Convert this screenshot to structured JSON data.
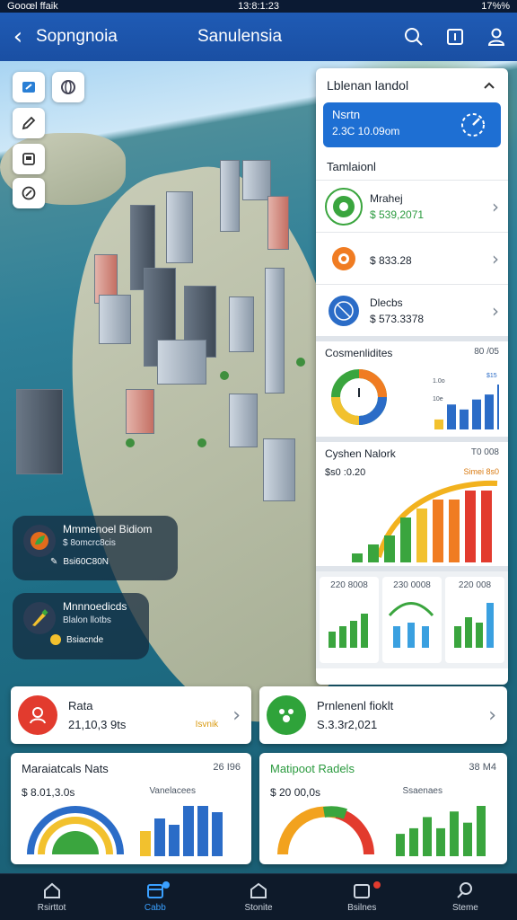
{
  "status": {
    "carrier": "Gooœl ffaik",
    "time": "13:8:1:23",
    "battery": "17%%"
  },
  "header": {
    "left_title": "Sopngnoia",
    "center_title": "Sanulensia"
  },
  "map_pois": [
    {
      "title": "Mmmenoel Bidiom",
      "subtitle": "$ 8omcrc8cis",
      "detail": "Bsi60C80N"
    },
    {
      "title": "Mnnnoedicds",
      "subtitle": "Blalon llotbs",
      "detail": "Bsiacnde"
    }
  ],
  "panel": {
    "title": "Lblenan landol",
    "featured": {
      "name": "Nsrtn",
      "value": "2.3C 10.09om"
    },
    "section": "Tamlaionl",
    "rows": [
      {
        "name": "Mrahej",
        "value": "$ 539,2071"
      },
      {
        "name": "",
        "value": "$ 833.28"
      },
      {
        "name": "Dlecbs",
        "value": "$ 573.3378"
      }
    ],
    "card1": {
      "title": "Cosmenlidites",
      "value": "80 /05",
      "bar_labels": [
        "1.0o",
        "10e",
        "$15"
      ]
    },
    "card2": {
      "title": "Cyshen Nalork",
      "value": "T0 008",
      "subtitle": "$s0 :0.20",
      "tag": "Simei 8s0"
    },
    "minis": [
      "220 8008",
      "230 0008",
      "220 008"
    ]
  },
  "cards": {
    "c1": {
      "name": "Rata",
      "value": "21,10,3 9ts",
      "tag": "Isvnik"
    },
    "c2": {
      "name": "Prnlenenl fioklt",
      "value": "S.3.3r2,021"
    },
    "c3": {
      "title": "Maraiatcals Nats",
      "value": "26 I96",
      "amount": "$ 8.01,3.0s",
      "label": "Vanelacees"
    },
    "c4": {
      "title": "Matipoot Radels",
      "value": "38 M4",
      "amount": "$ 20 00,0s",
      "label": "Ssaenaes"
    }
  },
  "nav": [
    {
      "label": "Rsirttot"
    },
    {
      "label": "Cabb"
    },
    {
      "label": "Stonite"
    },
    {
      "label": "Bsilnes"
    },
    {
      "label": "Steme"
    }
  ],
  "chart_data": [
    {
      "type": "bar",
      "title": "Cosmenlidites",
      "values": [
        2,
        5,
        4,
        6,
        7,
        9
      ]
    },
    {
      "type": "bar",
      "title": "Cyshen Nalork",
      "values": [
        1,
        2,
        3,
        5,
        6,
        7,
        7,
        8,
        8
      ]
    },
    {
      "type": "bar",
      "title": "Maraiatcals Nats",
      "values": [
        4,
        6,
        5,
        8,
        8,
        7
      ]
    },
    {
      "type": "bar",
      "title": "Matipoot Radels",
      "values": [
        4,
        5,
        7,
        5,
        8,
        6,
        9
      ]
    }
  ],
  "colors": {
    "header": "#1f5bb5",
    "accent": "#1e6fd3",
    "green": "#2a9a3e",
    "active_nav": "#3aa0ff"
  }
}
